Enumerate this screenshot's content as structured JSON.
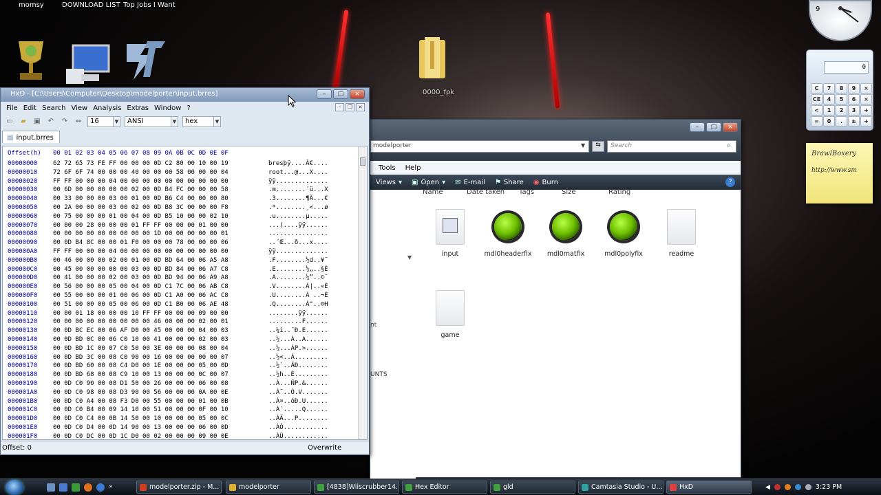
{
  "desktop": {
    "top_links": [
      "momsy",
      "DOWNLOAD LIST",
      "Top Jobs I Want"
    ],
    "folder_label": "0000_fpk",
    "colors": {
      "red_accent": "#ff2020",
      "hxd_title": "#7f98b8",
      "explorer_frame": "#2f3a46"
    }
  },
  "hxd": {
    "title": "HxD - [C:\\Users\\Computer\\Desktop\\modelporter\\input.brres]",
    "menu": [
      "File",
      "Edit",
      "Search",
      "View",
      "Analysis",
      "Extras",
      "Window",
      "?"
    ],
    "toolbar": {
      "bytes_per_row": "16",
      "charset": "ANSI",
      "display": "hex"
    },
    "tab": "input.brres",
    "offset_header": "Offset(h)",
    "bytes_header": "00 01 02 03 04 05 06 07 08 09 0A 0B 0C 0D 0E 0F",
    "ascii_header": "",
    "offsets": "00000000\n00000010\n00000020\n00000030\n00000040\n00000050\n00000060\n00000070\n00000080\n00000090\n000000A0\n000000B0\n000000C0\n000000D0\n000000E0\n000000F0\n00000100\n00000110\n00000120\n00000130\n00000140\n00000150\n00000160\n00000170\n00000180\n00000190\n000001A0\n000001B0\n000001C0\n000001D0\n000001E0\n000001F0",
    "bytes": "62 72 65 73 FE FF 00 00 00 0D C2 80 00 10 00 19\n72 6F 6F 74 00 00 00 40 00 00 00 58 00 00 00 04\nFF FF 00 00 00 04 00 00 00 00 00 00 00 00 00 00\n00 6D 00 00 00 00 00 02 00 0D B4 FC 00 00 00 58\n00 33 00 00 00 03 00 01 00 0D B6 C4 00 00 00 80\n00 2A 00 00 00 03 00 02 00 0D B8 3C 00 00 00 F8\n00 75 00 00 00 01 00 04 00 0D B5 10 00 00 02 10\n00 00 00 28 00 00 00 01 FF FF 00 00 00 01 00 00\n00 00 00 00 00 00 00 00 00 1D 00 00 00 00 00 01\n00 0D B4 8C 00 00 01 F0 00 00 00 78 00 00 00 06\nFF FF 00 00 00 04 00 00 00 00 00 00 00 00 00 00\n00 46 00 00 00 02 00 01 00 0D BD 64 00 06 A5 A8\n00 45 00 00 00 00 00 03 00 0D BD 84 00 06 A7 C8\n00 41 00 00 00 02 00 03 00 0D BD 94 00 06 A9 A8\n00 56 00 00 00 05 00 04 00 0D C1 7C 00 06 AB C8\n00 55 00 00 00 01 00 06 00 0D C1 A0 00 06 AC C8\n00 51 00 00 00 05 00 06 00 0D C1 B0 00 06 AE 48\n00 00 01 18 00 00 00 10 FF FF 00 00 00 09 00 00\n00 00 00 00 00 00 00 00 00 46 00 00 00 02 00 01\n00 0D BC EC 00 06 AF D0 00 45 00 00 00 04 00 03\n00 0D BD 0C 00 06 C0 10 00 41 00 00 00 02 00 03\n00 0D BD 1C 00 07 C0 50 00 3E 00 00 00 08 00 04\n00 0D BD 3C 00 08 C0 90 00 16 00 00 00 00 00 07\n00 0D BD 60 00 08 C4 D0 00 1E 00 00 00 05 00 0D\n00 0D BD 68 00 08 C9 10 00 13 00 00 00 0C 00 07\n00 0D C0 90 00 08 D1 50 00 26 00 00 00 06 00 08\n00 0D C0 98 00 08 D3 90 00 56 00 00 00 0A 00 0E\n00 0D C0 A4 00 08 F3 D0 00 55 00 00 00 01 00 0B\n00 0D C0 B4 00 09 14 10 00 51 00 00 00 0F 00 10\n00 0D C0 C4 00 0B 14 50 00 10 00 00 00 05 00 0C\n00 0D C0 D4 00 0D 14 90 00 13 00 00 00 06 00 0D\n00 0D C0 DC 00 0D 1C D0 00 02 00 00 00 09 00 0E",
    "ascii": "bresþÿ....Â€....\nroot...@...X....\nÿÿ..............\n.m........´ü...X\n.3........¶Ä...€\n.*........¸<...ø\n.u........µ.....\n...(....ÿÿ......\n................\n..´Œ...ð...x....\nÿÿ..............\n.F........½d..¥¨\n.E........½„..§È\n.A........½”..©¨\n.V........Á|..«È\n.U........Á ..¬È\n.Q........Á°..®H\n........ÿÿ......\n.........F......\n..¼ì..¯Ð.E......\n..½...À..A......\n..½...ÀP.>......\n..½<..À.........\n..½`..ÄÐ........\n..½h..É.........\n..À...ÑP.&......\n..À˜..Ó.V.......\n..À¤..óÐ.U......\n..À´.....Q......\n..ÀÄ...P........\n..ÀÔ............\n..ÀÜ............",
    "status": {
      "offset": "Offset: 0",
      "mode": "Overwrite"
    }
  },
  "explorer": {
    "address": "modelporter",
    "search_placeholder": "Search",
    "menu": [
      "Tools",
      "Help"
    ],
    "commands": [
      "Views",
      "Open",
      "E-mail",
      "Share",
      "Burn"
    ],
    "columns": [
      "Name",
      "Date taken",
      "Tags",
      "Size",
      "Rating"
    ],
    "nav_fragments": [
      "UNTS"
    ],
    "files": [
      {
        "name": "input",
        "icon": "file-settings-icon"
      },
      {
        "name": "mdl0headerfix",
        "icon": "gear-app-icon"
      },
      {
        "name": "mdl0matfix",
        "icon": "gear-app-icon"
      },
      {
        "name": "mdl0polyfix",
        "icon": "gear-app-icon"
      },
      {
        "name": "readme",
        "icon": "blank-file-icon"
      },
      {
        "name": "game",
        "icon": "blank-file-icon"
      }
    ]
  },
  "gadgets": {
    "calc_display": "0",
    "calc_keys": [
      "C",
      "7",
      "8",
      "9",
      "×",
      "CE",
      "4",
      "5",
      "6",
      "×",
      "<",
      "1",
      "2",
      "3",
      "+",
      "=",
      "0",
      ".",
      "±",
      "+"
    ],
    "note_lines": [
      "BrawlBoxery",
      "http://www.sm"
    ]
  },
  "taskbar": {
    "items": [
      {
        "label": "modelporter.zip - M...",
        "color": "#d04020"
      },
      {
        "label": "modelporter",
        "color": "#e0b030"
      },
      {
        "label": "[4838]Wiiscrubber14...",
        "color": "#40a040"
      },
      {
        "label": "Hex Editor",
        "color": "#40a040"
      },
      {
        "label": "gld",
        "color": "#40a040"
      },
      {
        "label": "Camtasia Studio - U...",
        "color": "#30a0a0"
      },
      {
        "label": "HxD",
        "color": "#e04040"
      }
    ],
    "clock": "3:23 PM"
  }
}
